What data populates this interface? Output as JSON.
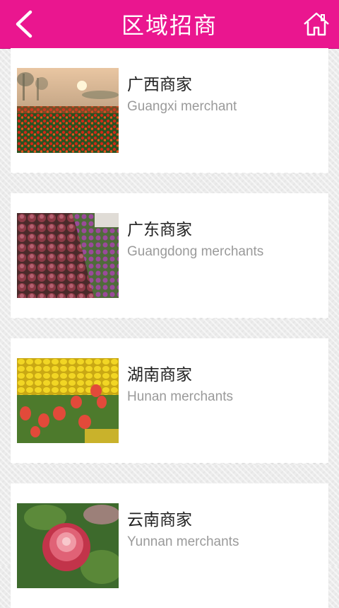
{
  "header": {
    "title": "区域招商",
    "back_icon": "chevron-left-icon",
    "home_icon": "home-icon",
    "color": "#ea168f"
  },
  "merchants": [
    {
      "name": "广西商家",
      "subtitle": "Guangxi merchant",
      "image": "tulip-field-sunrise"
    },
    {
      "name": "广东商家",
      "subtitle": "Guangdong merchants",
      "image": "red-purple-flowers"
    },
    {
      "name": "湖南商家",
      "subtitle": "Hunan merchants",
      "image": "yellow-red-tulips"
    },
    {
      "name": "云南商家",
      "subtitle": "Yunnan merchants",
      "image": "pink-peony"
    }
  ]
}
